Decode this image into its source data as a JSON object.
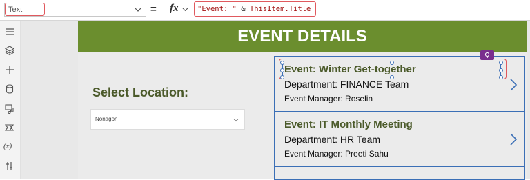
{
  "formula_bar": {
    "property": "Text",
    "equals": "=",
    "fx_label": "fx",
    "formula": {
      "string_literal": "\"Event: \"",
      "operator": " & ",
      "reference": "ThisItem.Title"
    }
  },
  "left_rail": {
    "items": [
      {
        "icon": "hamburger-menu-icon"
      },
      {
        "icon": "layers-icon"
      },
      {
        "icon": "plus-insert-icon"
      },
      {
        "icon": "database-icon"
      },
      {
        "icon": "media-icon"
      },
      {
        "icon": "power-automate-icon"
      },
      {
        "icon": "variables-icon",
        "label": "(x)"
      },
      {
        "icon": "advanced-tools-icon"
      }
    ]
  },
  "screen": {
    "header_title": "EVENT DETAILS",
    "select_label": "Select Location:",
    "location_dropdown": {
      "selected": "Nonagon"
    },
    "gallery": {
      "items": [
        {
          "title": "Event: Winter Get-together",
          "department": "Department: FINANCE Team",
          "manager": "Event Manager: Roselin"
        },
        {
          "title": "Event: IT Monthly Meeting",
          "department": "Department: HR Team",
          "manager": "Event Manager: Preeti Sahu"
        }
      ]
    }
  },
  "colors": {
    "header": "#6b8e2e",
    "label": "#4b5a2a",
    "selection": "#3b6fb6",
    "highlight": "#e0595e",
    "badge": "#7a2e8e"
  }
}
